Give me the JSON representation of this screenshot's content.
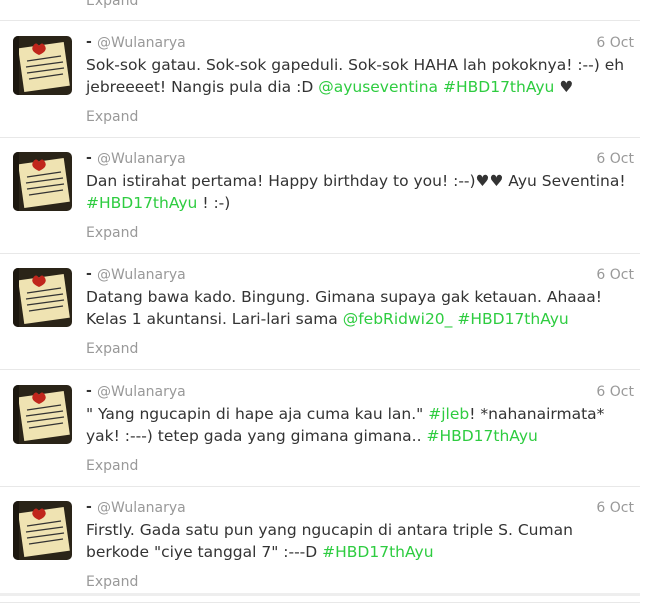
{
  "timeline": {
    "top_expand_label": "Expand",
    "tweets": [
      {
        "dash": "-",
        "username": "@Wulanarya",
        "date": "6 Oct",
        "parts": [
          {
            "t": "Sok-sok gatau. Sok-sok gapeduli. Sok-sok HAHA lah pokoknya! :--) eh jebreeeet! Nangis pula dia :D ",
            "link": false
          },
          {
            "t": "@ayuseventina",
            "link": true
          },
          {
            "t": " ",
            "link": false
          },
          {
            "t": "#HBD17thAyu",
            "link": true
          },
          {
            "t": " ♥",
            "link": false
          }
        ],
        "expand": "Expand"
      },
      {
        "dash": "-",
        "username": "@Wulanarya",
        "date": "6 Oct",
        "parts": [
          {
            "t": "Dan istirahat pertama! Happy birthday to you! :--)♥♥ Ayu Seventina! ",
            "link": false
          },
          {
            "t": "#HBD17thAyu",
            "link": true
          },
          {
            "t": " ! :-)",
            "link": false
          }
        ],
        "expand": "Expand"
      },
      {
        "dash": "-",
        "username": "@Wulanarya",
        "date": "6 Oct",
        "parts": [
          {
            "t": "Datang bawa kado. Bingung. Gimana supaya gak ketauan. Ahaaa! Kelas 1 akuntansi. Lari-lari sama ",
            "link": false
          },
          {
            "t": "@febRidwi20_",
            "link": true
          },
          {
            "t": " ",
            "link": false
          },
          {
            "t": "#HBD17thAyu",
            "link": true
          }
        ],
        "expand": "Expand"
      },
      {
        "dash": "-",
        "username": "@Wulanarya",
        "date": "6 Oct",
        "parts": [
          {
            "t": "\" Yang ngucapin di hape aja cuma kau lan.\" ",
            "link": false
          },
          {
            "t": "#jleb",
            "link": true
          },
          {
            "t": "! *nahanairmata* yak! :---) tetep gada yang gimana gimana.. ",
            "link": false
          },
          {
            "t": "#HBD17thAyu",
            "link": true
          }
        ],
        "expand": "Expand"
      },
      {
        "dash": "-",
        "username": "@Wulanarya",
        "date": "6 Oct",
        "parts": [
          {
            "t": "Firstly. Gada satu pun yang ngucapin di antara triple S. Cuman berkode \"ciye tanggal 7\" :---D  ",
            "link": false
          },
          {
            "t": "#HBD17thAyu",
            "link": true
          }
        ],
        "expand": "Expand"
      }
    ]
  },
  "colors": {
    "link": "#2ecc40",
    "muted": "#999999",
    "text": "#333333"
  }
}
